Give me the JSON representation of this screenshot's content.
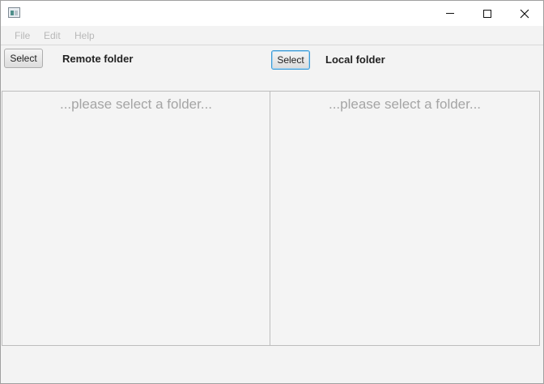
{
  "titlebar": {
    "app_icon": "app-window-icon",
    "controls": {
      "minimize": "minimize-icon",
      "maximize": "maximize-icon",
      "close": "✕"
    }
  },
  "menubar": {
    "items": [
      {
        "label": "File"
      },
      {
        "label": "Edit"
      },
      {
        "label": "Help"
      }
    ]
  },
  "remote": {
    "select_label": "Select",
    "title": "Remote folder",
    "placeholder": "...please select a folder..."
  },
  "local": {
    "select_label": "Select",
    "title": "Local folder",
    "placeholder": "...please select a folder..."
  },
  "colors": {
    "accent_focus": "#3c9bd6",
    "disabled_text": "#b8b8b8",
    "placeholder_text": "#a5a5a5"
  }
}
